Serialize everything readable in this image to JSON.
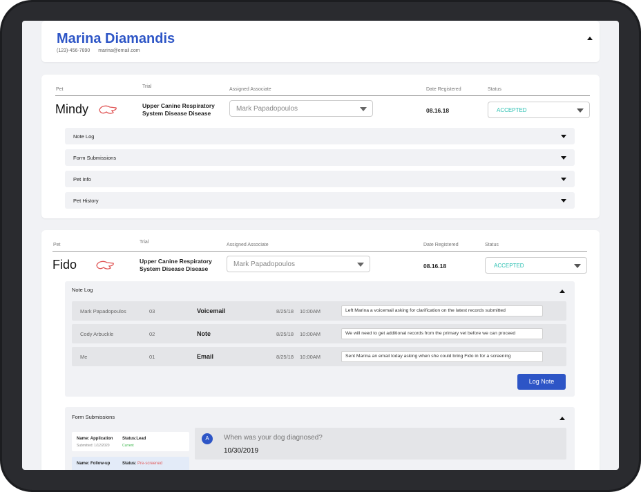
{
  "owner": {
    "name": "Marina Diamandis",
    "phone": "(123)-456-7890",
    "email": "marina@email.com"
  },
  "columns": {
    "pet": "Pet",
    "trial": "Trial",
    "associate": "Assigned Associate",
    "date": "Date Registered",
    "status": "Status"
  },
  "pets": [
    {
      "name": "Mindy",
      "trial": "Upper Canine Respiratory System Disease Disease",
      "associate": "Mark Papadopoulos",
      "date": "08.16.18",
      "status": "ACCEPTED",
      "sections": [
        "Note Log",
        "Form Submissions",
        "Pet Info",
        "Pet History"
      ]
    },
    {
      "name": "Fido",
      "trial": "Upper Canine Respiratory System Disease Disease",
      "associate": "Mark Papadopoulos",
      "date": "08.16.18",
      "status": "ACCEPTED"
    }
  ],
  "note_log": {
    "title": "Note Log",
    "rows": [
      {
        "author": "Mark Papadopoulos",
        "num": "03",
        "type": "Voicemail",
        "date": "8/25/18",
        "time": "10:00AM",
        "text": "Left Marina a voicemail asking for clarification on the latest records submitted"
      },
      {
        "author": "Cody Arbuckle",
        "num": "02",
        "type": "Note",
        "date": "8/25/18",
        "time": "10:00AM",
        "text": "We will need to get additional records from the primary vet before we can proceed"
      },
      {
        "author": "Me",
        "num": "01",
        "type": "Email",
        "date": "8/25/18",
        "time": "10:00AM",
        "text": "Sent Marina an email today asking when she could bring Fido in for a screening"
      }
    ],
    "button": "Log Note"
  },
  "form_submissions": {
    "title": "Form Submissions",
    "items": [
      {
        "name_label": "Name:",
        "name": "Application",
        "status_label": "Status:",
        "status": "Lead",
        "submitted": "Submitted: 1/12/2020",
        "current": "Current"
      },
      {
        "name_label": "Name:",
        "name": "Follow-up",
        "status_label": "Status:",
        "status": "Pre-screened"
      }
    ],
    "question": {
      "badge": "A",
      "text": "When was your dog diagnosed?",
      "answer": "10/30/2019"
    }
  },
  "colors": {
    "accent": "#2d55c6",
    "status": "#27bfb0",
    "paw": "#e05555"
  }
}
